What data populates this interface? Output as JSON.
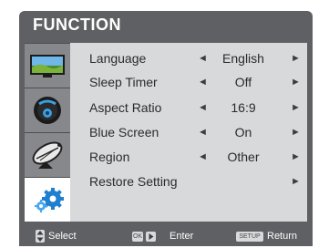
{
  "header": {
    "title": "FUNCTION"
  },
  "tabs": [
    {
      "name": "picture-tab",
      "icon": "tv-landscape-icon"
    },
    {
      "name": "sound-tab",
      "icon": "speaker-icon"
    },
    {
      "name": "channel-tab",
      "icon": "satellite-dish-icon"
    },
    {
      "name": "function-tab",
      "icon": "gears-icon",
      "active": true
    }
  ],
  "menu": [
    {
      "label": "Language",
      "value": "English",
      "left_arrow": "◄",
      "right_arrow": "►"
    },
    {
      "label": "Sleep Timer",
      "value": "Off",
      "left_arrow": "◄",
      "right_arrow": "►"
    },
    {
      "label": "Aspect Ratio",
      "value": "16:9",
      "left_arrow": "◄",
      "right_arrow": "►"
    },
    {
      "label": "Blue Screen",
      "value": "On",
      "left_arrow": "◄",
      "right_arrow": "►"
    },
    {
      "label": "Region",
      "value": "Other",
      "left_arrow": "◄",
      "right_arrow": "►"
    },
    {
      "label": "Restore Setting",
      "value": "",
      "left_arrow": "",
      "right_arrow": "►"
    }
  ],
  "footer": {
    "select_label": "Select",
    "ok_key": "OK",
    "enter_label": "Enter",
    "setup_key": "SETUP",
    "return_label": "Return"
  },
  "colors": {
    "frame": "#5f6063",
    "panel": "#d8d9db",
    "rail": "#87888b",
    "active_tab": "#ffffff",
    "text": "#2b2b2d"
  }
}
